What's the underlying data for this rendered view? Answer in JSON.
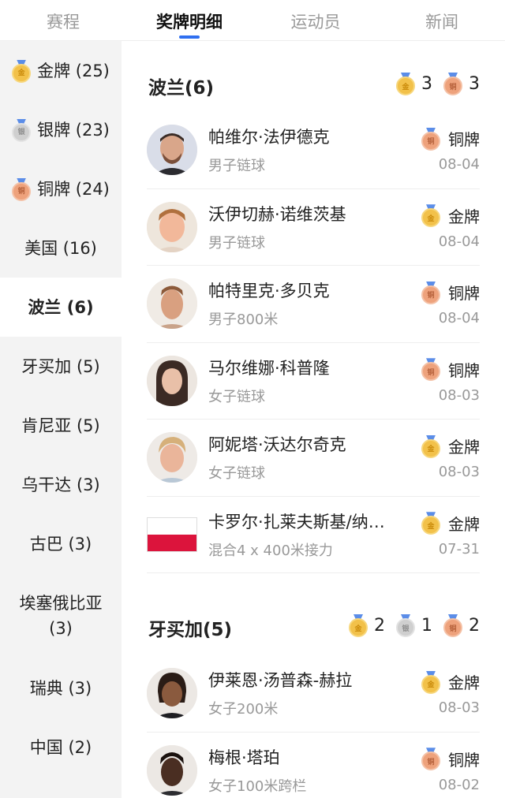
{
  "tabs": [
    "赛程",
    "奖牌明细",
    "运动员",
    "新闻"
  ],
  "sidebar": {
    "items": [
      {
        "label": "金牌 (25)",
        "medal": "gold"
      },
      {
        "label": "银牌 (23)",
        "medal": "silver"
      },
      {
        "label": "铜牌 (24)",
        "medal": "bronze"
      },
      {
        "label": "美国 (16)"
      },
      {
        "label": "波兰 (6)"
      },
      {
        "label": "牙买加 (5)"
      },
      {
        "label": "肯尼亚 (5)"
      },
      {
        "label": "乌干达 (3)"
      },
      {
        "label": "古巴 (3)"
      },
      {
        "label": "埃塞俄比亚 (3)"
      },
      {
        "label": "瑞典 (3)"
      },
      {
        "label": "中国 (2)"
      }
    ]
  },
  "medal_glyphs": {
    "gold": "金",
    "silver": "银",
    "bronze": "铜"
  },
  "sections": [
    {
      "country": "波兰(6)",
      "counts": [
        {
          "medal": "gold",
          "value": "3"
        },
        {
          "medal": "bronze",
          "value": "3"
        }
      ],
      "rows": [
        {
          "name": "帕维尔·法伊德克",
          "event": "男子链球",
          "medal": "bronze",
          "medal_label": "铜牌",
          "date": "08-04"
        },
        {
          "name": "沃伊切赫·诺维茨基",
          "event": "男子链球",
          "medal": "gold",
          "medal_label": "金牌",
          "date": "08-04"
        },
        {
          "name": "帕特里克·多贝克",
          "event": "男子800米",
          "medal": "bronze",
          "medal_label": "铜牌",
          "date": "08-04"
        },
        {
          "name": "马尔维娜·科普隆",
          "event": "女子链球",
          "medal": "bronze",
          "medal_label": "铜牌",
          "date": "08-03"
        },
        {
          "name": "阿妮塔·沃达尔奇克",
          "event": "女子链球",
          "medal": "gold",
          "medal_label": "金牌",
          "date": "08-03"
        },
        {
          "name": "卡罗尔·扎莱夫斯基/纳…",
          "event": "混合4 x 400米接力",
          "medal": "gold",
          "medal_label": "金牌",
          "date": "07-31",
          "flag": true
        }
      ]
    },
    {
      "country": "牙买加(5)",
      "counts": [
        {
          "medal": "gold",
          "value": "2"
        },
        {
          "medal": "silver",
          "value": "1"
        },
        {
          "medal": "bronze",
          "value": "2"
        }
      ],
      "rows": [
        {
          "name": "伊莱恩·汤普森-赫拉",
          "event": "女子200米",
          "medal": "gold",
          "medal_label": "金牌",
          "date": "08-03"
        },
        {
          "name": "梅根·塔珀",
          "event": "女子100米跨栏",
          "medal": "bronze",
          "medal_label": "铜牌",
          "date": "08-02"
        }
      ]
    }
  ]
}
